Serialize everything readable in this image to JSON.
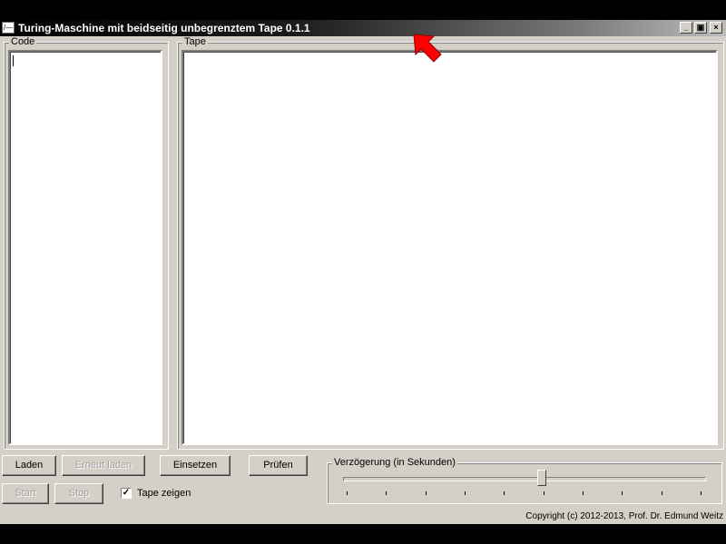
{
  "window": {
    "title": "Turing-Maschine mit beidseitig unbegrenztem Tape 0.1.1",
    "icon_text": "/—",
    "controls": {
      "minimize": "_",
      "restore": "▣",
      "close": "×"
    }
  },
  "code_panel": {
    "label": "Code",
    "content": ""
  },
  "tape_panel": {
    "label": "Tape",
    "content": ""
  },
  "buttons": {
    "laden": "Laden",
    "erneut_laden": "Erneut laden",
    "einsetzen": "Einsetzen",
    "pruefen": "Prüfen",
    "start": "Start",
    "stop": "Stop"
  },
  "tape_zeigen": {
    "label": "Tape zeigen",
    "checked": true,
    "check_mark": "✓"
  },
  "delay": {
    "label": "Verzögerung (in Sekunden)",
    "value_fraction": 0.55,
    "tick_count": 10
  },
  "copyright": "Copyright (c) 2012-2013, Prof. Dr. Edmund Weitz",
  "colors": {
    "window_bg": "#d4d0c8",
    "cursor": "#ff0000"
  },
  "icons": {
    "cursor": "red-arrow-cursor-icon"
  }
}
